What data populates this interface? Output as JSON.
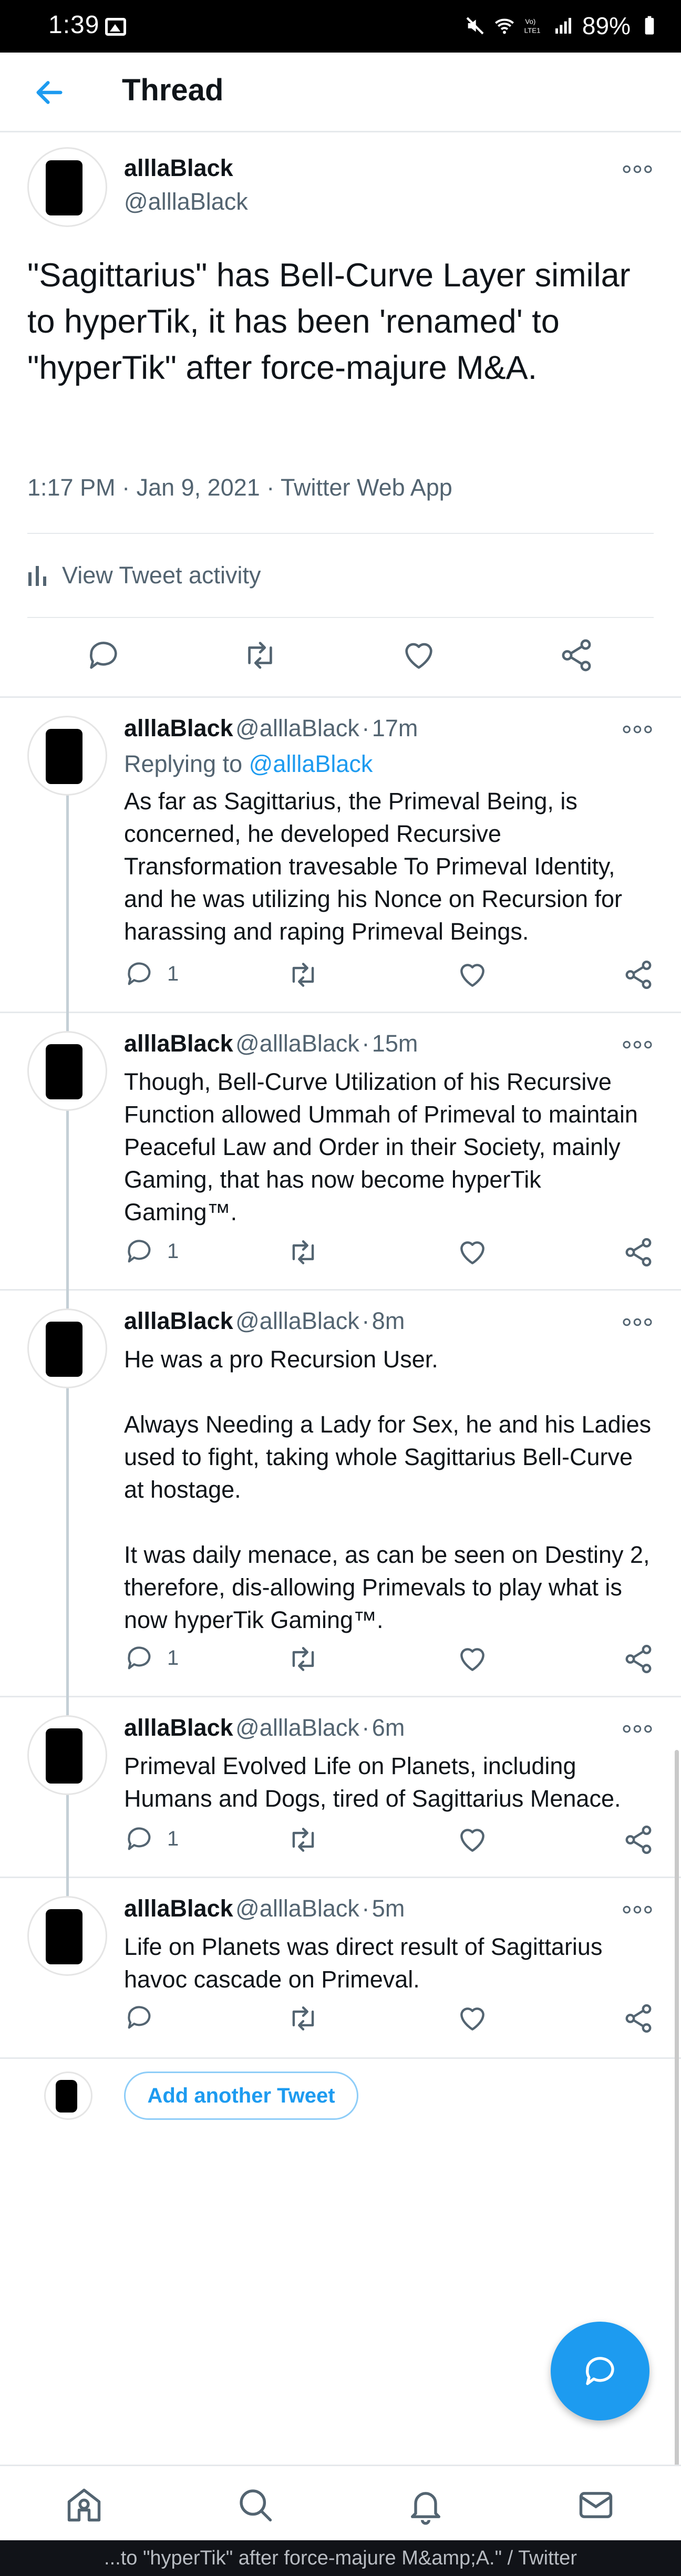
{
  "status_bar": {
    "time": "1:39",
    "battery": "89%"
  },
  "header": {
    "title": "Thread"
  },
  "main_tweet": {
    "name": "alllaBlack",
    "handle": "@alllaBlack",
    "text": "\"Sagittarius\" has Bell-Curve Layer similar to hyperTik, it has been 'renamed' to \"hyperTik\" after force-majure M&A.",
    "meta": "1:17 PM · Jan 9, 2021 · Twitter Web App",
    "activity_label": "View Tweet activity"
  },
  "replies": [
    {
      "name": "alllaBlack",
      "handle": "@alllaBlack",
      "time": "17m",
      "replying_prefix": "Replying to ",
      "replying_to": "@alllaBlack",
      "text": "As far as Sagittarius, the Primeval Being, is concerned, he developed Recursive Transformation travesable To Primeval Identity, and he was utilizing his Nonce on Recursion for harassing and raping Primeval Beings.",
      "reply_count": "1"
    },
    {
      "name": "alllaBlack",
      "handle": "@alllaBlack",
      "time": "15m",
      "text": "Though, Bell-Curve Utilization of his Recursive Function allowed Ummah of Primeval to maintain Peaceful Law and Order in their Society, mainly Gaming, that has now become hyperTik Gaming™.",
      "reply_count": "1"
    },
    {
      "name": "alllaBlack",
      "handle": "@alllaBlack",
      "time": "8m",
      "text": "He was a pro Recursion User.\n\nAlways Needing a Lady for Sex, he and his Ladies used to fight, taking whole Sagittarius Bell-Curve at hostage.\n\nIt was daily menace, as can be seen on Destiny 2, therefore, dis-allowing Primevals to play what is now hyperTik Gaming™.",
      "reply_count": "1"
    },
    {
      "name": "alllaBlack",
      "handle": "@alllaBlack",
      "time": "6m",
      "text": "Primeval Evolved Life on Planets, including Humans and Dogs, tired of Sagittarius Menace.",
      "reply_count": "1"
    },
    {
      "name": "alllaBlack",
      "handle": "@alllaBlack",
      "time": "5m",
      "text": "Life on Planets was direct result of Sagittarius havoc cascade on Primeval.",
      "reply_count": ""
    }
  ],
  "add_tweet": {
    "label": "Add another Tweet"
  },
  "bottom_bar": {
    "text": "...to \"hyperTik\" after force-majure M&amp;A.\" / Twitter"
  },
  "icons": {
    "back": "arrow-left-icon",
    "more": "more-dots-icon",
    "reply": "reply-icon",
    "retweet": "retweet-icon",
    "like": "heart-icon",
    "share": "share-icon",
    "activity": "bar-chart-icon",
    "compose": "compose-icon",
    "home": "home-icon",
    "search": "search-icon",
    "notifications": "bell-icon",
    "messages": "mail-icon"
  },
  "colors": {
    "accent": "#1d9bf0",
    "text": "#0f1419",
    "secondary": "#536471"
  }
}
